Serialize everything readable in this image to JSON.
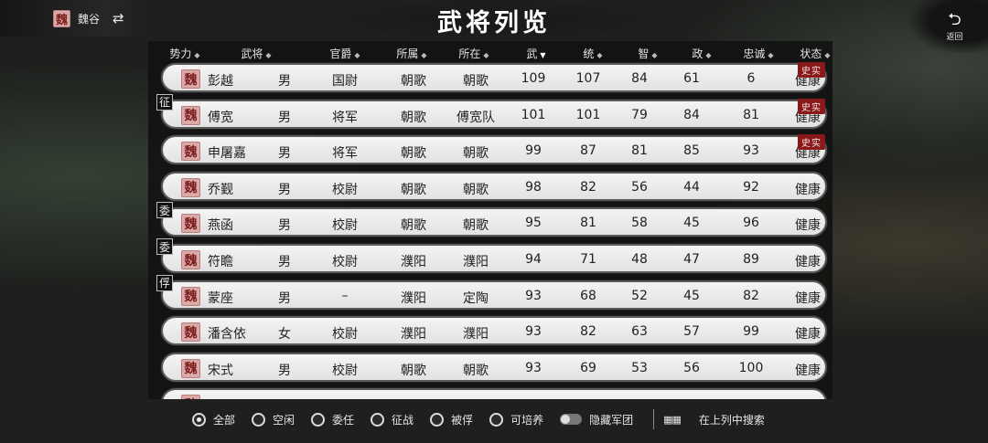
{
  "faction": {
    "seal": "魏",
    "name": "魏谷",
    "swap_icon": "⇄"
  },
  "title": "武将列览",
  "back": {
    "arrow": "⮌",
    "label": "返回"
  },
  "header": [
    {
      "label": "势力",
      "sort": "◆",
      "active": false
    },
    {
      "label": "武将",
      "sort": "◆",
      "active": false
    },
    {
      "label": "官爵",
      "sort": "◆",
      "active": false
    },
    {
      "label": "所属",
      "sort": "◆",
      "active": false
    },
    {
      "label": "所在",
      "sort": "◆",
      "active": false
    },
    {
      "label": "武",
      "sort": "▼",
      "active": true
    },
    {
      "label": "统",
      "sort": "◆",
      "active": false
    },
    {
      "label": "智",
      "sort": "◆",
      "active": false
    },
    {
      "label": "政",
      "sort": "◆",
      "active": false
    },
    {
      "label": "忠诚",
      "sort": "◆",
      "active": false
    },
    {
      "label": "状态",
      "sort": "◆",
      "active": false
    }
  ],
  "rows": [
    {
      "tag": "",
      "seal": "魏",
      "name": "彭越",
      "gender": "男",
      "rank": "国尉",
      "belong": "朝歌",
      "location": "朝歌",
      "wu": "109",
      "tong": "107",
      "zhi": "84",
      "zheng": "61",
      "loyalty": "6",
      "status": "健康",
      "badge": "史实"
    },
    {
      "tag": "征",
      "seal": "魏",
      "name": "傅宽",
      "gender": "男",
      "rank": "将军",
      "belong": "朝歌",
      "location": "傅宽队",
      "wu": "101",
      "tong": "101",
      "zhi": "79",
      "zheng": "84",
      "loyalty": "81",
      "status": "健康",
      "badge": "史实"
    },
    {
      "tag": "",
      "seal": "魏",
      "name": "申屠嘉",
      "gender": "男",
      "rank": "将军",
      "belong": "朝歌",
      "location": "朝歌",
      "wu": "99",
      "tong": "87",
      "zhi": "81",
      "zheng": "85",
      "loyalty": "93",
      "status": "健康",
      "badge": "史实"
    },
    {
      "tag": "",
      "seal": "魏",
      "name": "乔觐",
      "gender": "男",
      "rank": "校尉",
      "belong": "朝歌",
      "location": "朝歌",
      "wu": "98",
      "tong": "82",
      "zhi": "56",
      "zheng": "44",
      "loyalty": "92",
      "status": "健康",
      "badge": ""
    },
    {
      "tag": "委",
      "seal": "魏",
      "name": "燕函",
      "gender": "男",
      "rank": "校尉",
      "belong": "朝歌",
      "location": "朝歌",
      "wu": "95",
      "tong": "81",
      "zhi": "58",
      "zheng": "45",
      "loyalty": "96",
      "status": "健康",
      "badge": ""
    },
    {
      "tag": "委",
      "seal": "魏",
      "name": "符瞻",
      "gender": "男",
      "rank": "校尉",
      "belong": "濮阳",
      "location": "濮阳",
      "wu": "94",
      "tong": "71",
      "zhi": "48",
      "zheng": "47",
      "loyalty": "89",
      "status": "健康",
      "badge": ""
    },
    {
      "tag": "俘",
      "seal": "魏",
      "name": "蒙座",
      "gender": "男",
      "rank": "–",
      "belong": "濮阳",
      "location": "定陶",
      "wu": "93",
      "tong": "68",
      "zhi": "52",
      "zheng": "45",
      "loyalty": "82",
      "status": "健康",
      "badge": ""
    },
    {
      "tag": "",
      "seal": "魏",
      "name": "潘含依",
      "gender": "女",
      "rank": "校尉",
      "belong": "濮阳",
      "location": "濮阳",
      "wu": "93",
      "tong": "82",
      "zhi": "63",
      "zheng": "57",
      "loyalty": "99",
      "status": "健康",
      "badge": ""
    },
    {
      "tag": "",
      "seal": "魏",
      "name": "宋式",
      "gender": "男",
      "rank": "校尉",
      "belong": "朝歌",
      "location": "朝歌",
      "wu": "93",
      "tong": "69",
      "zhi": "53",
      "zheng": "56",
      "loyalty": "100",
      "status": "健康",
      "badge": ""
    },
    {
      "tag": "",
      "seal": "魏",
      "name": "",
      "gender": "",
      "rank": "",
      "belong": "",
      "location": "",
      "wu": "",
      "tong": "",
      "zhi": "",
      "zheng": "",
      "loyalty": "",
      "status": "",
      "badge": ""
    }
  ],
  "filters": [
    {
      "label": "全部",
      "selected": true
    },
    {
      "label": "空闲",
      "selected": false
    },
    {
      "label": "委任",
      "selected": false
    },
    {
      "label": "征战",
      "selected": false
    },
    {
      "label": "被俘",
      "selected": false
    },
    {
      "label": "可培养",
      "selected": false
    }
  ],
  "hide_legion": {
    "label": "隐藏军团"
  },
  "search": {
    "icon": "▦▦",
    "label": "在上列中搜索"
  }
}
